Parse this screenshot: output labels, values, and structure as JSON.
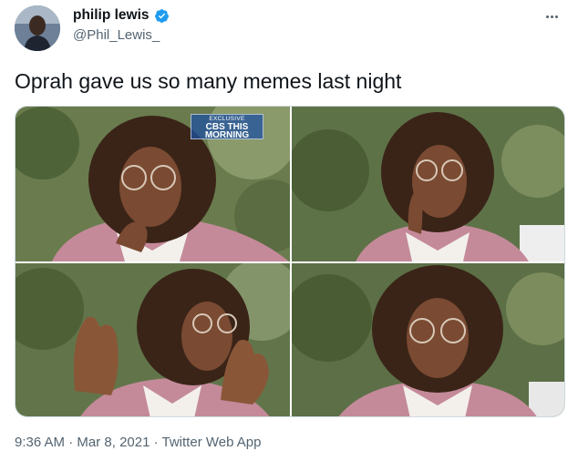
{
  "author": {
    "display_name": "philip lewis",
    "handle": "@Phil_Lewis_",
    "verified_icon": "verified-badge-icon"
  },
  "tweet": {
    "text": "Oprah gave us so many memes last night"
  },
  "media": {
    "watermark_top": "EXCLUSIVE",
    "watermark_main": "CBS THIS MORNING"
  },
  "meta": {
    "time": "9:36 AM",
    "separator": "·",
    "date": "Mar 8, 2021",
    "source": "Twitter Web App"
  },
  "colors": {
    "text": "#0f1419",
    "secondary": "#536471",
    "verified": "#1d9bf0",
    "sweater": "#c48a9a"
  }
}
